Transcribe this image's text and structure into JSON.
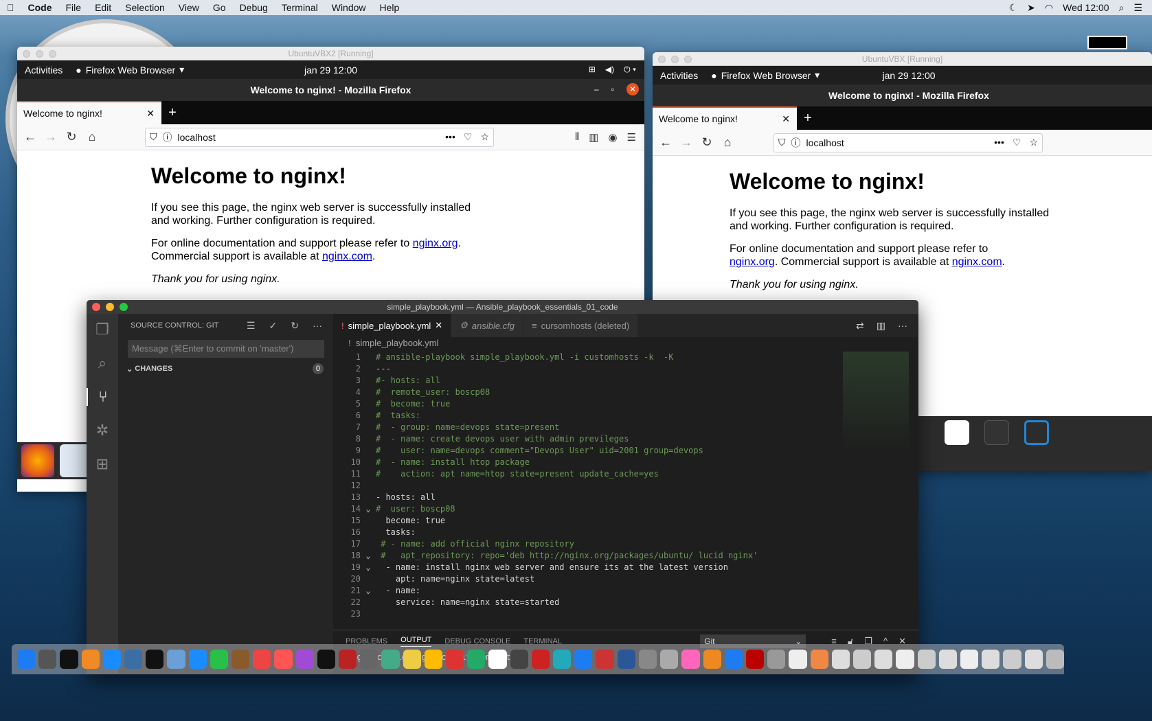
{
  "menubar": {
    "app": "Code",
    "items": [
      "File",
      "Edit",
      "Selection",
      "View",
      "Go",
      "Debug",
      "Terminal",
      "Window",
      "Help"
    ],
    "clock": "Wed 12:00"
  },
  "vm_left": {
    "title": "UbuntuVBX2 [Running]",
    "activities": "Activities",
    "app_menu": "Firefox Web Browser",
    "date": "jan 29  12:00",
    "window_title": "Welcome to nginx! - Mozilla Firefox",
    "tab": "Welcome to nginx!",
    "url": "localhost"
  },
  "vm_right": {
    "title": "UbuntuVBX [Running]",
    "activities": "Activities",
    "app_menu": "Firefox Web Browser",
    "date": "jan 29  12:00",
    "window_title": "Welcome to nginx! - Mozilla Firefox",
    "tab": "Welcome to nginx!",
    "url": "localhost"
  },
  "nginx": {
    "heading": "Welcome to nginx!",
    "p1": "If you see this page, the nginx web server is successfully installed and working. Further configuration is required.",
    "p2_pre": "For online documentation and support please refer to ",
    "link1": "nginx.org",
    "p2_mid": ". Commercial support is available at ",
    "link2": "nginx.com",
    "p2_end": ".",
    "thanks": "Thank you for using nginx."
  },
  "vscode": {
    "title": "simple_playbook.yml — Ansible_playbook_essentials_01_code",
    "sidebar_title": "SOURCE CONTROL: GIT",
    "commit_placeholder": "Message (⌘Enter to commit on 'master')",
    "changes_label": "CHANGES",
    "changes_count": "0",
    "tabs": [
      "simple_playbook.yml",
      "ansible.cfg",
      "cursomhosts (deleted)"
    ],
    "breadcrumb": "simple_playbook.yml",
    "panel_tabs": [
      "PROBLEMS",
      "OUTPUT",
      "DEBUG CONSOLE",
      "TERMINAL"
    ],
    "output_select": "Git",
    "output_line": "> git config --get commit.template",
    "code": [
      {
        "n": "1",
        "f": "",
        "c": "cm",
        "t": "# ansible-playbook simple_playbook.yml -i customhosts -k  -K"
      },
      {
        "n": "2",
        "f": "",
        "c": "t",
        "t": "---"
      },
      {
        "n": "3",
        "f": "",
        "c": "cm",
        "t": "#- hosts: all"
      },
      {
        "n": "4",
        "f": "",
        "c": "cm",
        "t": "#  remote_user: boscp08"
      },
      {
        "n": "5",
        "f": "",
        "c": "cm",
        "t": "#  become: true"
      },
      {
        "n": "6",
        "f": "",
        "c": "cm",
        "t": "#  tasks:"
      },
      {
        "n": "7",
        "f": "",
        "c": "cm",
        "t": "#  - group: name=devops state=present"
      },
      {
        "n": "8",
        "f": "",
        "c": "cm",
        "t": "#  - name: create devops user with admin previleges"
      },
      {
        "n": "9",
        "f": "",
        "c": "cm",
        "t": "#    user: name=devops comment=\"Devops User\" uid=2001 group=devops"
      },
      {
        "n": "10",
        "f": "",
        "c": "cm",
        "t": "#  - name: install htop package"
      },
      {
        "n": "11",
        "f": "",
        "c": "cm",
        "t": "#    action: apt name=htop state=present update_cache=yes"
      },
      {
        "n": "12",
        "f": "",
        "c": "t",
        "t": ""
      },
      {
        "n": "13",
        "f": "",
        "c": "t",
        "t": "- hosts: all"
      },
      {
        "n": "14",
        "f": "⌄",
        "c": "cm",
        "t": "#  user: boscp08"
      },
      {
        "n": "15",
        "f": "",
        "c": "t",
        "t": "  become: true"
      },
      {
        "n": "16",
        "f": "",
        "c": "t",
        "t": "  tasks:"
      },
      {
        "n": "17",
        "f": "",
        "c": "cm",
        "t": " # - name: add official nginx repository"
      },
      {
        "n": "18",
        "f": "⌄",
        "c": "cm",
        "t": " #   apt_repository: repo='deb http://nginx.org/packages/ubuntu/ lucid nginx'"
      },
      {
        "n": "19",
        "f": "⌄",
        "c": "t",
        "t": "  - name: install nginx web server and ensure its at the latest version"
      },
      {
        "n": "20",
        "f": "",
        "c": "t",
        "t": "    apt: name=nginx state=latest"
      },
      {
        "n": "21",
        "f": "⌄",
        "c": "t",
        "t": "  - name:"
      },
      {
        "n": "22",
        "f": "",
        "c": "t",
        "t": "    service: name=nginx state=started"
      },
      {
        "n": "23",
        "f": "",
        "c": "t",
        "t": ""
      }
    ]
  },
  "colors": {
    "accent": "#e95420",
    "link": "#0000cc",
    "vscode_bg": "#1e1e1e",
    "comment": "#6a9955"
  }
}
